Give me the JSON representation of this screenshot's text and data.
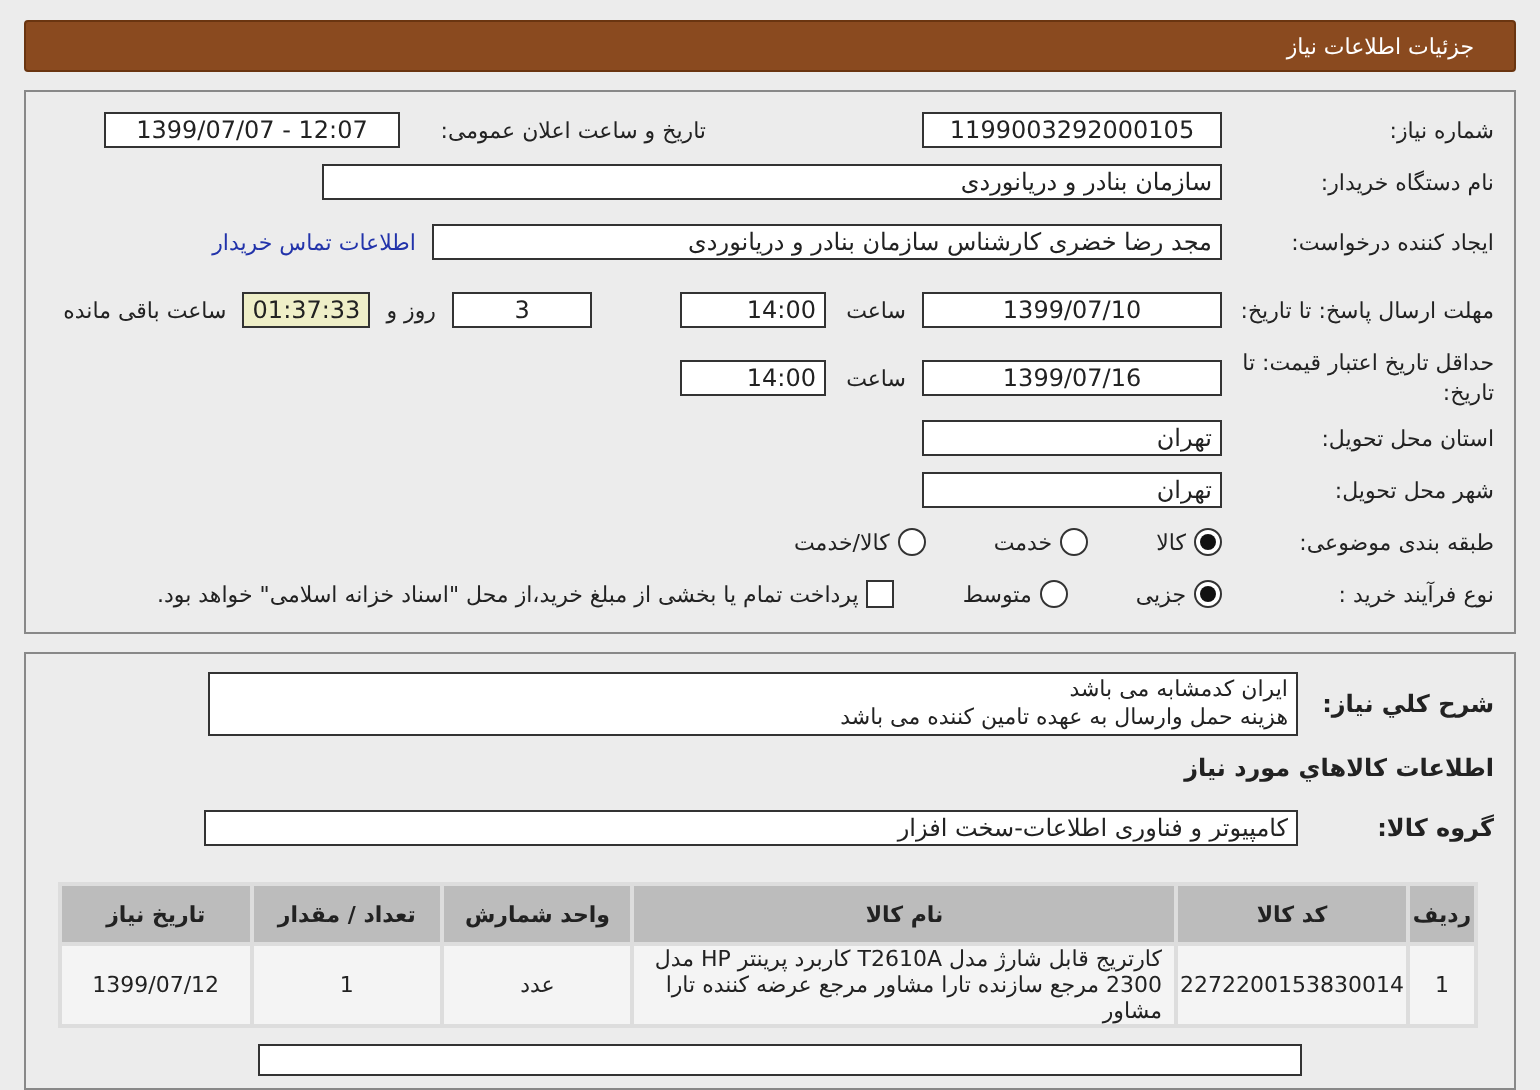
{
  "header": {
    "title": "جزئیات اطلاعات نیاز"
  },
  "details": {
    "need_number": {
      "label": "شماره نیاز:",
      "value": "1199003292000105"
    },
    "announce": {
      "label": "تاریخ و ساعت اعلان عمومی:",
      "value": "1399/07/07 - 12:07"
    },
    "buyer": {
      "label": "نام دستگاه خریدار:",
      "value": "سازمان بنادر و دریانوردی"
    },
    "creator": {
      "label": "ایجاد کننده درخواست:",
      "value": "مجد رضا خضری کارشناس سازمان بنادر و دریانوردی",
      "link": "اطلاعات تماس خریدار"
    },
    "deadline": {
      "label": "مهلت ارسال پاسخ: تا تاریخ:",
      "date": "1399/07/10",
      "time_label": "ساعت",
      "time": "14:00",
      "days": "3",
      "days_label": "روز و",
      "remaining": "01:37:33",
      "remaining_label": "ساعت باقی مانده"
    },
    "validity": {
      "label": "حداقل تاریخ اعتبار قیمت: تا تاریخ:",
      "date": "1399/07/16",
      "time_label": "ساعت",
      "time": "14:00"
    },
    "province": {
      "label": "استان محل تحویل:",
      "value": "تهران"
    },
    "city": {
      "label": "شهر محل تحویل:",
      "value": "تهران"
    },
    "category": {
      "label": "طبقه بندی موضوعی:",
      "options": [
        {
          "label": "کالا",
          "selected": true
        },
        {
          "label": "خدمت",
          "selected": false
        },
        {
          "label": "کالا/خدمت",
          "selected": false
        }
      ]
    },
    "process": {
      "label": "نوع فرآیند خرید :",
      "options": [
        {
          "label": "جزیی",
          "selected": true
        },
        {
          "label": "متوسط",
          "selected": false
        }
      ],
      "payment": {
        "label": "پرداخت تمام یا بخشی از مبلغ خرید،از محل \"اسناد خزانه اسلامی\" خواهد بود.",
        "checked": false
      }
    }
  },
  "items": {
    "description": {
      "label": "شرح کلي نياز:",
      "lines": [
        "ایران کدمشابه می باشد",
        "هزینه حمل وارسال به عهده تامین کننده می باشد"
      ]
    },
    "section_title": "اطلاعات کالاهاي مورد نياز",
    "group": {
      "label": "گروه کالا:",
      "value": "کامپیوتر و فناوری اطلاعات-سخت افزار"
    },
    "table": {
      "columns": [
        "ردیف",
        "کد کالا",
        "نام کالا",
        "واحد شمارش",
        "تعداد / مقدار",
        "تاریخ نیاز"
      ],
      "rows": [
        [
          "1",
          "2272200153830014",
          "کارتریج قابل شارژ مدل T2610A کاربرد پرینتر HP مدل 2300 مرجع سازنده تارا مشاور مرجع عرضه کننده تارا مشاور",
          "عدد",
          "1",
          "1399/07/12"
        ]
      ]
    }
  }
}
